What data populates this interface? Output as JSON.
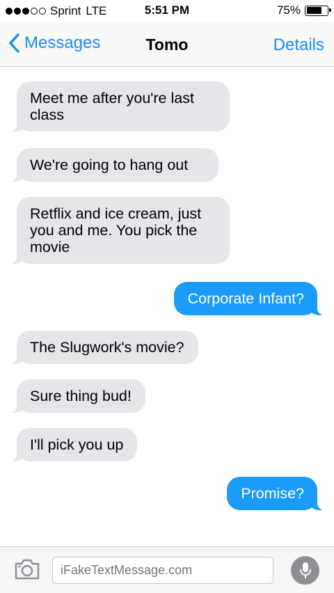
{
  "status_bar": {
    "signal_dots_filled": 3,
    "signal_dots_total": 5,
    "carrier": "Sprint",
    "network": "LTE",
    "time": "5:51 PM",
    "battery_percent": "75%",
    "battery_level": 0.75
  },
  "nav": {
    "back_label": "Messages",
    "title": "Tomo",
    "details_label": "Details"
  },
  "messages": [
    {
      "direction": "incoming",
      "text": "Meet me after you're last class"
    },
    {
      "direction": "incoming",
      "text": "We're going to hang out"
    },
    {
      "direction": "incoming",
      "text": "Retflix and ice cream, just you and me. You pick the movie"
    },
    {
      "direction": "outgoing",
      "text": "Corporate Infant?"
    },
    {
      "direction": "incoming",
      "text": "The Slugwork's movie?"
    },
    {
      "direction": "incoming",
      "text": "Sure thing bud!"
    },
    {
      "direction": "incoming",
      "text": "I'll pick you up"
    },
    {
      "direction": "outgoing",
      "text": "Promise?"
    }
  ],
  "input_bar": {
    "placeholder": "iFakeTextMessage.com",
    "camera_icon": "camera-icon",
    "mic_icon": "microphone-icon"
  },
  "colors": {
    "accent": "#1a8cf5",
    "outgoing_bubble": "#1a9bf8",
    "incoming_bubble": "#e5e5ea"
  }
}
